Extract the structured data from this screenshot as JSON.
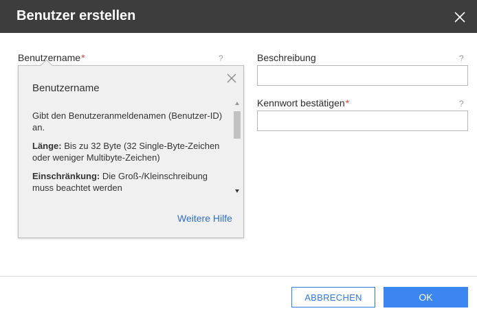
{
  "dialog": {
    "title": "Benutzer erstellen"
  },
  "fields": {
    "username": {
      "label": "Benutzername",
      "required_mark": "*",
      "help_mark": "?"
    },
    "description": {
      "label": "Beschreibung",
      "help_mark": "?",
      "value": ""
    },
    "confirm_password": {
      "label": "Kennwort bestätigen",
      "required_mark": "*",
      "help_mark": "?",
      "value": ""
    }
  },
  "help_popup": {
    "title": "Benutzername",
    "paragraph1": "Gibt den Benutzeranmeldenamen (Benutzer-ID) an.",
    "length_label": "Länge:",
    "length_text": " Bis zu 32 Byte (32 Single-Byte-Zeichen oder weniger Multibyte-Zeichen)",
    "restriction_label": "Einschränkung:",
    "restriction_text": " Die Groß-/Kleinschreibung muss beachtet werden",
    "more_help_link": "Weitere Hilfe"
  },
  "footer": {
    "cancel_label": "ABBRECHEN",
    "ok_label": "OK"
  },
  "colors": {
    "title_bar": "#3d3d3d",
    "accent": "#3b86f0",
    "required": "#e0443e",
    "link": "#2e6fc7"
  },
  "icons": [
    "close-icon",
    "popup-close-icon",
    "scroll-up-arrow-icon",
    "scroll-down-arrow-icon"
  ]
}
